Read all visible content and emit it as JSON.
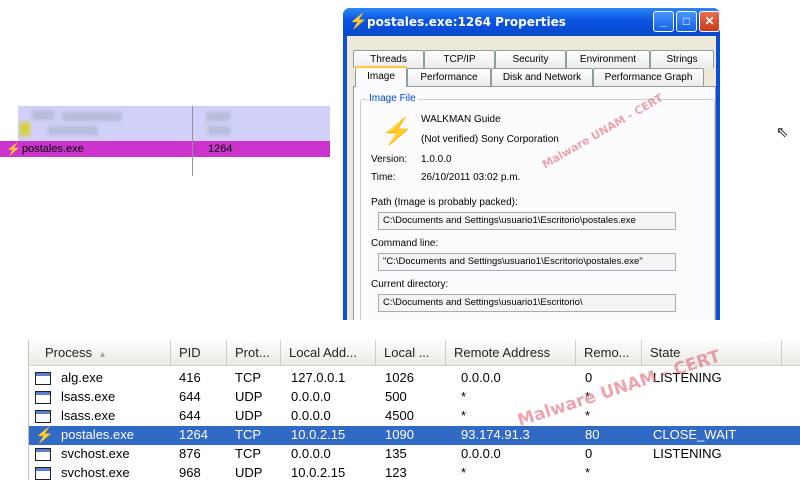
{
  "process_fragment": {
    "name": "postales.exe",
    "pid": "1264"
  },
  "properties_window": {
    "title": "postales.exe:1264 Properties",
    "tabs_row1": [
      "Threads",
      "TCP/IP",
      "Security",
      "Environment",
      "Strings"
    ],
    "tabs_row2": [
      "Image",
      "Performance",
      "Disk and Network",
      "Performance Graph"
    ],
    "active_tab": "Image",
    "group_label": "Image File",
    "description": "WALKMAN Guide",
    "company": "(Not verified) Sony Corporation",
    "version_label": "Version:",
    "version": "1.0.0.0",
    "time_label": "Time:",
    "time": "26/10/2011 03:02 p.m.",
    "path_label": "Path (Image is probably packed):",
    "path": "C:\\Documents and Settings\\usuario1\\Escritorio\\postales.exe",
    "cmdline_label": "Command line:",
    "cmdline": "\"C:\\Documents and Settings\\usuario1\\Escritorio\\postales.exe\"",
    "curdir_label": "Current directory:",
    "curdir": "C:\\Documents and Settings\\usuario1\\Escritorio\\",
    "watermark": "Malware UNAM - CERT"
  },
  "network": {
    "columns": [
      "Process",
      "PID",
      "Prot...",
      "Local Add...",
      "Local ...",
      "Remote Address",
      "Remo...",
      "State"
    ],
    "rows": [
      {
        "process": "alg.exe",
        "pid": "416",
        "proto": "TCP",
        "local_addr": "127.0.0.1",
        "local_port": "1026",
        "remote_addr": "0.0.0.0",
        "remote_port": "0",
        "state": "LISTENING"
      },
      {
        "process": "lsass.exe",
        "pid": "644",
        "proto": "UDP",
        "local_addr": "0.0.0.0",
        "local_port": "500",
        "remote_addr": "*",
        "remote_port": "*",
        "state": ""
      },
      {
        "process": "lsass.exe",
        "pid": "644",
        "proto": "UDP",
        "local_addr": "0.0.0.0",
        "local_port": "4500",
        "remote_addr": "*",
        "remote_port": "*",
        "state": ""
      },
      {
        "process": "postales.exe",
        "pid": "1264",
        "proto": "TCP",
        "local_addr": "10.0.2.15",
        "local_port": "1090",
        "remote_addr": "93.174.91.3",
        "remote_port": "80",
        "state": "CLOSE_WAIT"
      },
      {
        "process": "svchost.exe",
        "pid": "876",
        "proto": "TCP",
        "local_addr": "0.0.0.0",
        "local_port": "135",
        "remote_addr": "0.0.0.0",
        "remote_port": "0",
        "state": "LISTENING"
      },
      {
        "process": "svchost.exe",
        "pid": "968",
        "proto": "UDP",
        "local_addr": "10.0.2.15",
        "local_port": "123",
        "remote_addr": "*",
        "remote_port": "*",
        "state": ""
      }
    ],
    "selected_row": 3,
    "watermark": "Malware UNAM - CERT"
  },
  "colors": {
    "selection_blue": "#316ac5",
    "highlight_magenta": "#cc33cc",
    "xp_title_blue": "#0a54e0"
  },
  "icons": {
    "process": "lightning-bolt-icon",
    "window": "application-window-icon",
    "cursor": "mouse-cursor-icon"
  }
}
